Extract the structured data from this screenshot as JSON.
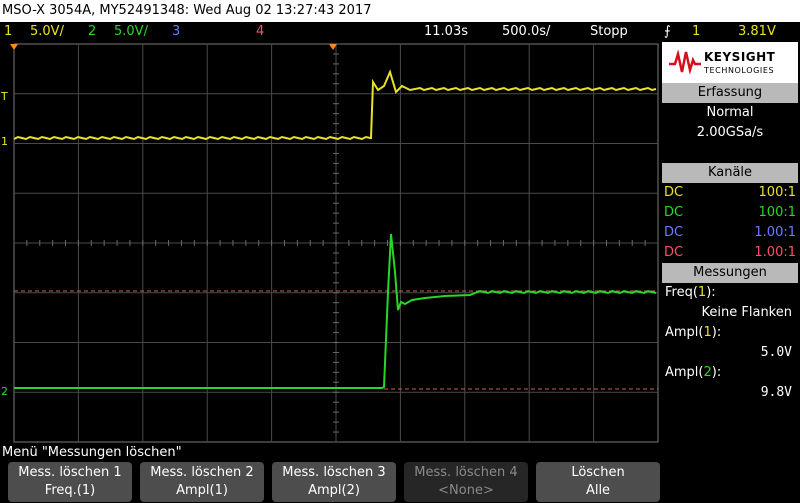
{
  "title": "MSO-X 3054A, MY52491348: Wed Aug 02 13:27:43 2017",
  "status": {
    "ch1_num": "1",
    "ch1_scale": "5.0V/",
    "ch2_num": "2",
    "ch2_scale": "5.0V/",
    "ch3_num": "3",
    "ch4_num": "4",
    "time_pos": "11.03s",
    "time_scale": "500.0s/",
    "run_state": "Stopp",
    "trig_symbol": "⨍",
    "trig_ch": "1",
    "trig_level": "3.81V"
  },
  "colors": {
    "ch1": "#e8e32a",
    "ch2": "#27d627",
    "ch3": "#6b7cff",
    "ch4": "#ff4d6d",
    "trigger": "#ff8a1a"
  },
  "logo": {
    "brand": "KEYSIGHT",
    "sub": "TECHNOLOGIES"
  },
  "acquisition": {
    "header": "Erfassung",
    "mode": "Normal",
    "rate": "2.00GSa/s"
  },
  "channels": {
    "header": "Kanäle",
    "rows": [
      {
        "coupling": "DC",
        "probe": "100:1"
      },
      {
        "coupling": "DC",
        "probe": "100:1"
      },
      {
        "coupling": "DC",
        "probe": "1.00:1"
      },
      {
        "coupling": "DC",
        "probe": "1.00:1"
      }
    ]
  },
  "measurements": {
    "header": "Messungen",
    "items": [
      {
        "name": "Freq(",
        "ch": "1",
        "close": "):",
        "value": "Keine Flanken"
      },
      {
        "name": "Ampl(",
        "ch": "1",
        "close": "):",
        "value": "5.0V"
      },
      {
        "name": "Ampl(",
        "ch": "2",
        "close": "):",
        "value": "9.8V"
      }
    ]
  },
  "menu": {
    "title": "Menü \"Messungen löschen\"",
    "softkeys": [
      {
        "line1": "Mess. löschen 1",
        "line2": "Freq.(1)",
        "enabled": true
      },
      {
        "line1": "Mess. löschen 2",
        "line2": "Ampl(1)",
        "enabled": true
      },
      {
        "line1": "Mess. löschen 3",
        "line2": "Ampl(2)",
        "enabled": true
      },
      {
        "line1": "Mess. löschen 4",
        "line2": "<None>",
        "enabled": false
      },
      {
        "line1": "Löschen",
        "line2": "Alle",
        "enabled": true
      }
    ]
  },
  "markers": {
    "trig_level_marker": "T",
    "ch1_marker": "1",
    "ch2_marker": "2"
  }
}
